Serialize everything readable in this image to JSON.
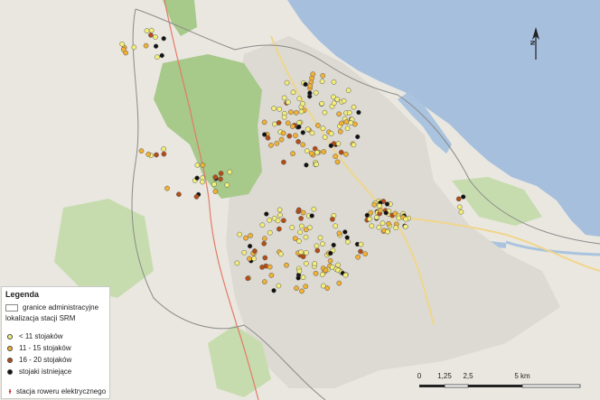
{
  "legend": {
    "title": "Legenda",
    "items": [
      {
        "key": "admin",
        "label": "granice administracyjne"
      },
      {
        "key": "srm",
        "label": "lokalizacja stacji SRM"
      },
      {
        "key": "lt11",
        "label": "< 11 stojaków",
        "color": "#f4ef7a"
      },
      {
        "key": "r11_15",
        "label": "11 - 15 stojaków",
        "color": "#f2b134"
      },
      {
        "key": "r16_20",
        "label": "16 - 20 stojaków",
        "color": "#b54d17"
      },
      {
        "key": "existing",
        "label": "stojaki istniejące",
        "color": "#111111"
      },
      {
        "key": "electric",
        "label": "stacja roweru elektrycznego",
        "color": "#d01010"
      }
    ]
  },
  "scale": {
    "ticks": [
      "0",
      "1,25",
      "2,5",
      "5 km"
    ]
  },
  "north": {
    "label": "N"
  },
  "colors": {
    "sea": "#a6bfdd",
    "land": "#e9e7e0",
    "city": "#dcdad2",
    "forest": "#a7c98a",
    "park": "#c7dcae",
    "water": "#aac3de",
    "road_major": "#f0d68c",
    "road_red": "#e47a66"
  }
}
